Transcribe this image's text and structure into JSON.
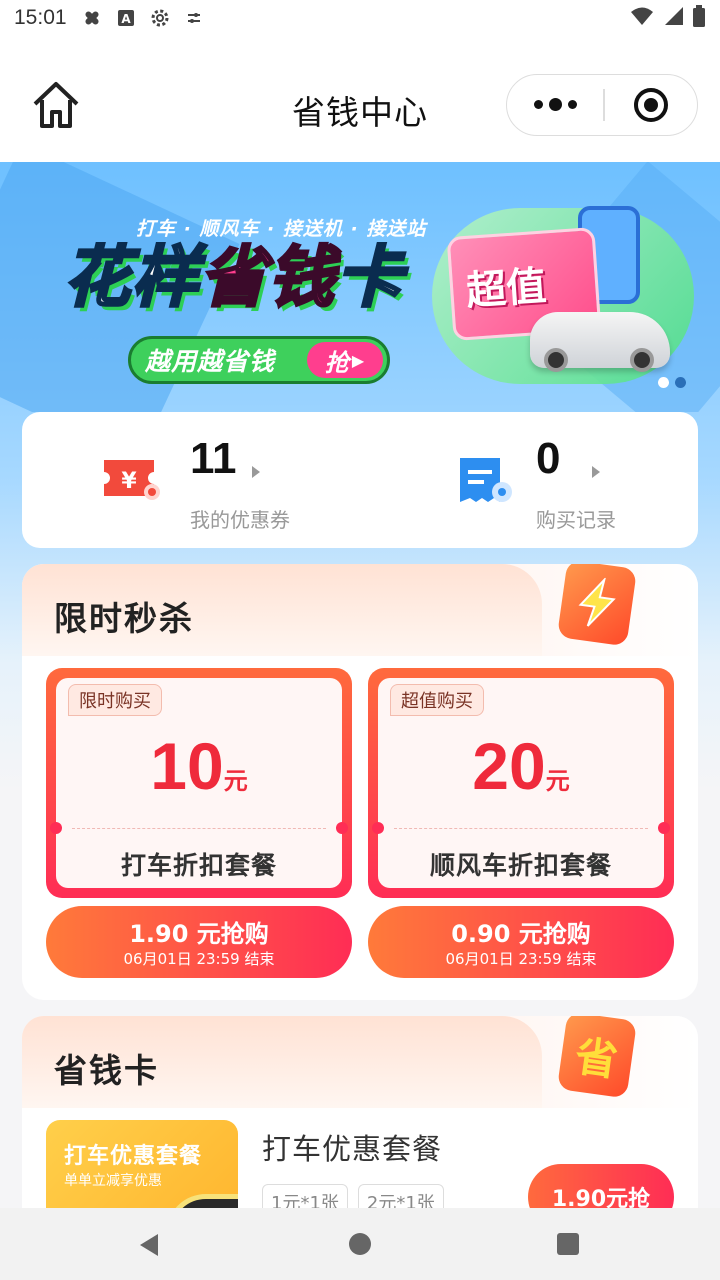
{
  "status_bar": {
    "time": "15:01"
  },
  "header": {
    "title": "省钱中心"
  },
  "banner": {
    "subtitle": "打车 · 顺风车 · 接送机 · 接送站",
    "headline_white": "花样",
    "headline_pink": "省钱",
    "headline_white2": "卡",
    "slogan": "越用越省钱",
    "grab": "抢",
    "card_text": "超值"
  },
  "summary": {
    "coupons": {
      "count": "11",
      "label": "我的优惠券",
      "icon": "coupon-icon"
    },
    "records": {
      "count": "0",
      "label": "购买记录",
      "icon": "receipt-icon"
    }
  },
  "flash_sale": {
    "title": "限时秒杀",
    "badge_icon": "lightning-icon",
    "deals": [
      {
        "tag": "限时购买",
        "amount": "10",
        "unit": "元",
        "name": "打车折扣套餐",
        "buy_price": "1.90 元抢购",
        "end_time": "06月01日 23:59 结束"
      },
      {
        "tag": "超值购买",
        "amount": "20",
        "unit": "元",
        "name": "顺风车折扣套餐",
        "buy_price": "0.90 元抢购",
        "end_time": "06月01日 23:59 结束"
      }
    ]
  },
  "savings_card": {
    "title": "省钱卡",
    "badge_text": "省",
    "package": {
      "image_title": "打车优惠套餐",
      "image_subtitle": "单单立减享优惠",
      "title": "打车优惠套餐",
      "chips": [
        "1元*1张",
        "2元*1张"
      ],
      "buy_label": "1.90元抢"
    }
  },
  "colors": {
    "accent": "#ff2d55",
    "price": "#ef2a3b",
    "banner_blue": "#6ec0ff"
  }
}
